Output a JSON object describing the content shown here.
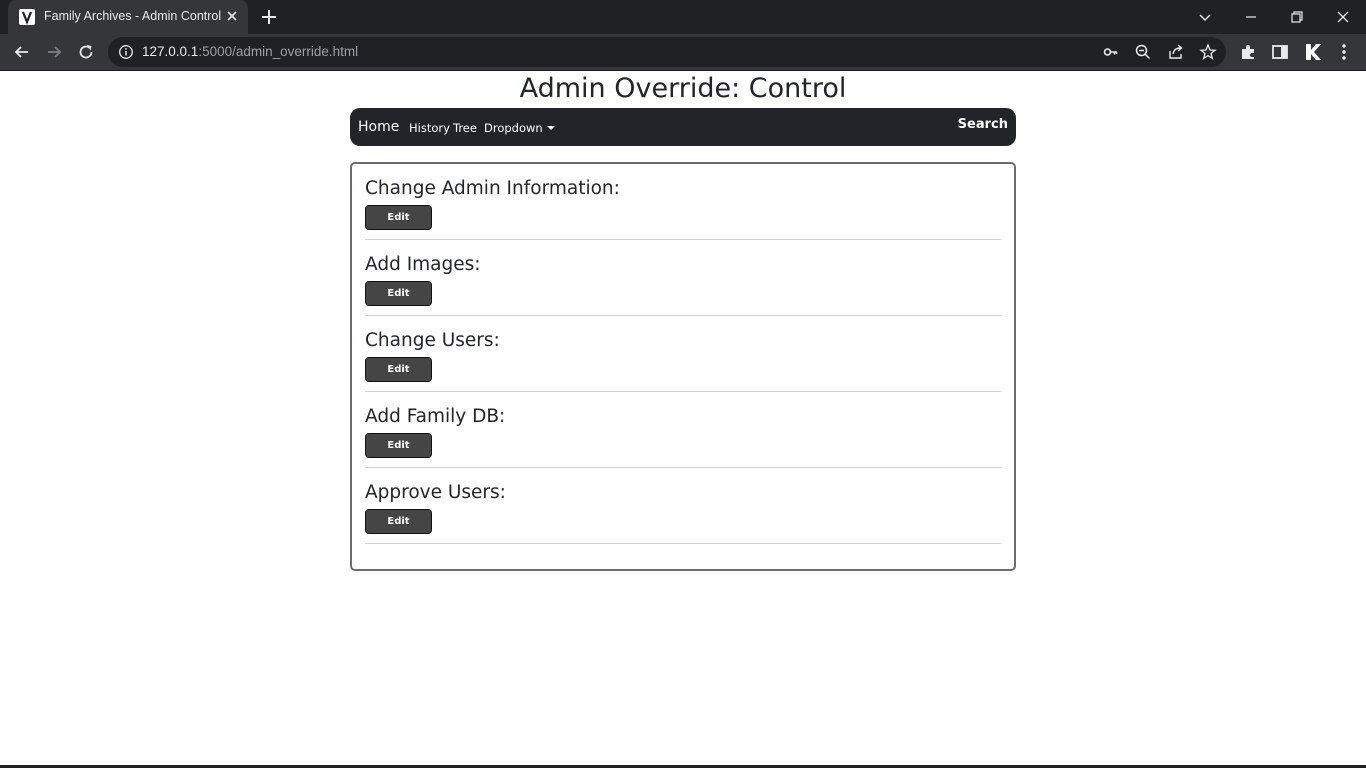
{
  "browser": {
    "tab_title": "Family Archives - Admin Control",
    "url_host": "127.0.0.1",
    "url_rest": ":5000/admin_override.html"
  },
  "page": {
    "title": "Admin Override: Control"
  },
  "navbar": {
    "brand": "Home",
    "links": [
      "History",
      "Tree",
      "Dropdown"
    ],
    "search": "Search"
  },
  "sections": [
    {
      "label": "Change Admin Information:",
      "button": "Edit"
    },
    {
      "label": "Add Images:",
      "button": "Edit"
    },
    {
      "label": "Change Users:",
      "button": "Edit"
    },
    {
      "label": "Add Family DB:",
      "button": "Edit"
    },
    {
      "label": "Approve Users:",
      "button": "Edit"
    }
  ],
  "icons": {
    "tab_favicon": "site-favicon-icon",
    "tab_close": "close-icon",
    "new_tab": "plus-icon",
    "back": "arrow-left-icon",
    "forward": "arrow-right-icon",
    "reload": "reload-icon",
    "site_info": "info-icon",
    "password": "key-icon",
    "zoom": "zoom-out-icon",
    "share": "share-icon",
    "bookmark": "star-icon",
    "extensions": "puzzle-icon",
    "side_panel": "side-panel-icon",
    "profile": "profile-k-icon",
    "menu": "kebab-menu-icon"
  }
}
